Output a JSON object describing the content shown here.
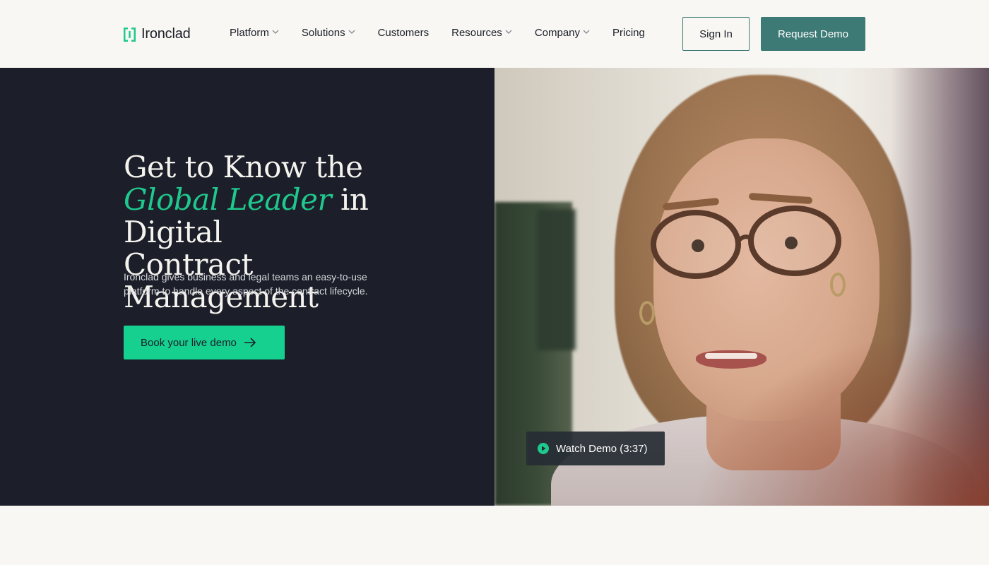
{
  "brand": {
    "name": "Ironclad",
    "accent_color": "#1fc98d",
    "primary_color": "#3d7a75",
    "dark_bg": "#1c1f2a"
  },
  "nav": {
    "items": [
      {
        "label": "Platform",
        "has_dropdown": true
      },
      {
        "label": "Solutions",
        "has_dropdown": true
      },
      {
        "label": "Customers",
        "has_dropdown": false
      },
      {
        "label": "Resources",
        "has_dropdown": true
      },
      {
        "label": "Company",
        "has_dropdown": true
      },
      {
        "label": "Pricing",
        "has_dropdown": false
      }
    ],
    "sign_in": "Sign In",
    "request_demo": "Request Demo"
  },
  "hero": {
    "title_line1": "Get to Know the",
    "title_highlight": "Global Leader",
    "title_line2_rest": " in Digital",
    "title_line3": "Contract Management",
    "subtitle": "Ironclad gives business and legal teams an easy-to-use platform to handle every aspect of the contract lifecycle.",
    "cta_label": "Book your live demo",
    "cta_icon": "arrow-right-icon",
    "watch_demo_label": "Watch Demo (3:37)",
    "watch_demo_icon": "play-icon"
  }
}
